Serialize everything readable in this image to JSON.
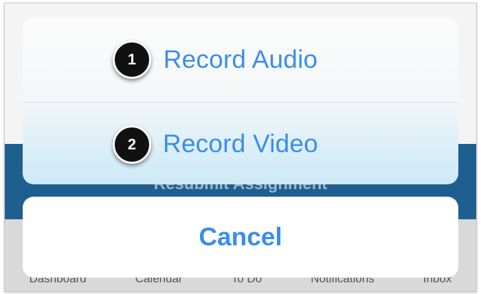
{
  "background": {
    "button_label": "Resubmit Assignment",
    "tabs": [
      "Dashboard",
      "Calendar",
      "To Do",
      "Notifications",
      "Inbox"
    ]
  },
  "action_sheet": {
    "actions": [
      {
        "label": "Record Audio",
        "step": "1"
      },
      {
        "label": "Record Video",
        "step": "2"
      }
    ],
    "cancel_label": "Cancel"
  },
  "colors": {
    "action_text": "#3a8ee8",
    "background_blue": "#1f5f8f",
    "step_badge": "#111111"
  }
}
